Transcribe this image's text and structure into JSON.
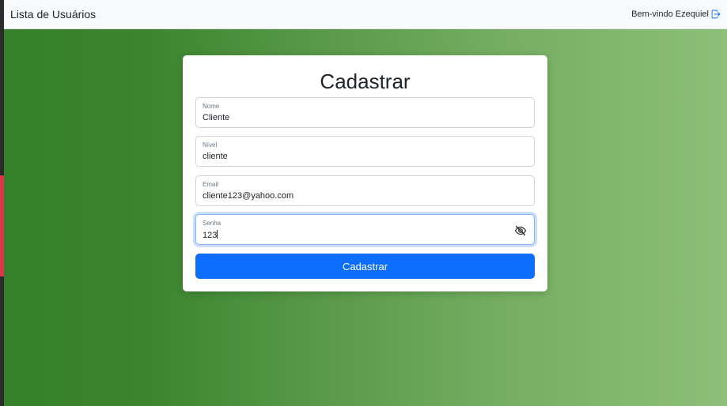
{
  "navbar": {
    "brand": "Lista de Usuários",
    "welcome": "Bem-vindo Ezequiel",
    "logout_icon": "logout-icon"
  },
  "form": {
    "title": "Cadastrar",
    "fields": [
      {
        "label": "Nome",
        "value": "Cliente"
      },
      {
        "label": "Nível",
        "value": "cliente"
      },
      {
        "label": "Email",
        "value": "cliente123@yahoo.com"
      },
      {
        "label": "Senha",
        "value": "123",
        "icon": "eye-slash-icon"
      }
    ],
    "submit_label": "Cadastrar"
  },
  "colors": {
    "primary": "#0d6efd",
    "background_gradient_start": "#35802a",
    "background_gradient_end": "#8cbf79",
    "focus_border": "#86b7fe",
    "left_accent": "#e0344c"
  }
}
